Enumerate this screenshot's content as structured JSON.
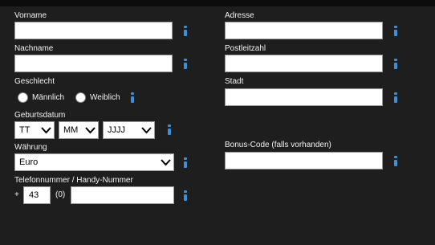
{
  "form": {
    "vorname_label": "Vorname",
    "nachname_label": "Nachname",
    "geschlecht_label": "Geschlecht",
    "gender_male": "Männlich",
    "gender_female": "Weiblich",
    "geburtsdatum_label": "Geburtsdatum",
    "day_selected": "TT",
    "month_selected": "MM",
    "year_selected": "JJJJ",
    "waehrung_label": "Währung",
    "currency_selected": "Euro",
    "telefon_label": "Telefonnummer / Handy-Nummer",
    "phone_plus": "+",
    "phone_country_code": "43",
    "phone_trunk": "(0)",
    "adresse_label": "Adresse",
    "postleitzahl_label": "Postleitzahl",
    "stadt_label": "Stadt",
    "bonus_label": "Bonus-Code (falls vorhanden)"
  },
  "colors": {
    "background": "#1e1e1e",
    "info_icon": "#3f8fd8"
  },
  "icons": {
    "info": "info-icon",
    "dropdown": "chevron-down-icon"
  }
}
